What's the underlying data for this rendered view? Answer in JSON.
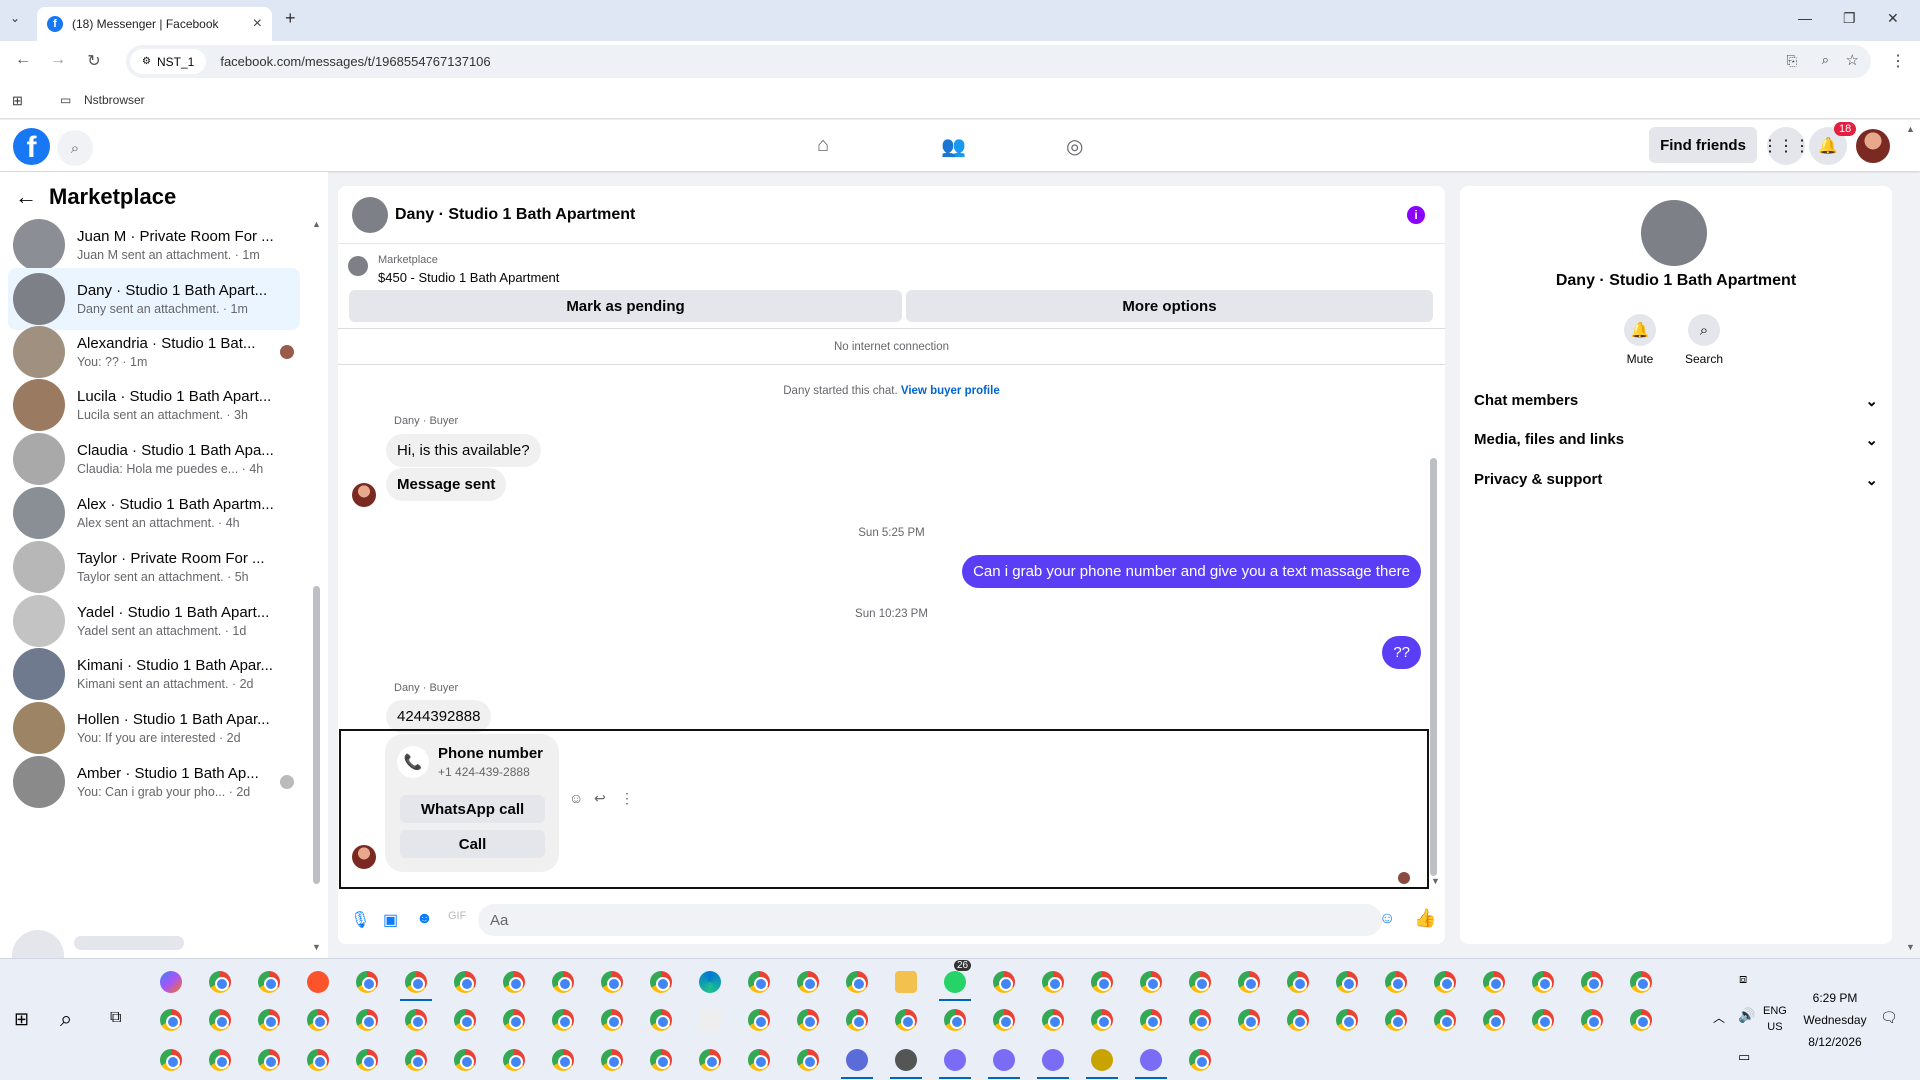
{
  "browser": {
    "tab_title": "(18) Messenger | Facebook",
    "profile": "NST_1",
    "url": "facebook.com/messages/t/1968554767137106",
    "bookmark": "Nstbrowser"
  },
  "header": {
    "find_friends": "Find friends",
    "notification_count": "18"
  },
  "sidebar": {
    "title": "Marketplace",
    "conversations": [
      {
        "name": "Juan M · Private Room For ...",
        "preview": "Juan M sent an attachment. · 1m",
        "color": "#8b8f95"
      },
      {
        "name": "Dany · Studio 1 Bath Apart...",
        "preview": "Dany sent an attachment. · 1m",
        "color": "#7d8086"
      },
      {
        "name": "Alexandria · Studio 1 Bat...",
        "preview": "You: ?? · 1m",
        "color": "#a09080"
      },
      {
        "name": "Lucila · Studio 1 Bath Apart...",
        "preview": "Lucila sent an attachment. · 3h",
        "color": "#9a7a60"
      },
      {
        "name": "Claudia · Studio 1 Bath Apa...",
        "preview": "Claudia: Hola me puedes e... · 4h",
        "color": "#a9a9a9"
      },
      {
        "name": "Alex · Studio 1 Bath Apartm...",
        "preview": "Alex sent an attachment. · 4h",
        "color": "#8a8f96"
      },
      {
        "name": "Taylor · Private Room For ...",
        "preview": "Taylor sent an attachment. · 5h",
        "color": "#b7b7b7"
      },
      {
        "name": "Yadel · Studio 1 Bath Apart...",
        "preview": "Yadel sent an attachment. · 1d",
        "color": "#c3c3c3"
      },
      {
        "name": "Kimani · Studio 1 Bath Apar...",
        "preview": "Kimani sent an attachment. · 2d",
        "color": "#6f7a8f"
      },
      {
        "name": "Hollen · Studio 1 Bath Apar...",
        "preview": "You: If you are interested · 2d",
        "color": "#9c8465"
      },
      {
        "name": "Amber · Studio 1 Bath Ap...",
        "preview": "You: Can i grab your pho... · 2d",
        "color": "#8a8a8a"
      }
    ]
  },
  "chat": {
    "title": "Dany · Studio 1 Bath Apartment",
    "listing_source": "Marketplace",
    "listing": "$450 - Studio 1 Bath Apartment",
    "mark_pending": "Mark as pending",
    "more_options": "More options",
    "no_internet": "No internet connection",
    "started": "Dany started this chat.",
    "view_profile": "View buyer profile",
    "sender_label_1": "Dany · Buyer",
    "msg_in_1": "Hi, is this available?",
    "msg_in_2": "Message sent",
    "time_1": "Sun 5:25 PM",
    "msg_out_1": "Can i grab your phone number and give  you a text massage there",
    "time_2": "Sun 10:23 PM",
    "msg_out_2": "??",
    "sender_label_2": "Dany · Buyer",
    "msg_in_3": "4244392888",
    "phone_label": "Phone number",
    "phone_value": "+1 424-439-2888",
    "whatsapp_call": "WhatsApp call",
    "call": "Call",
    "input_placeholder": "Aa"
  },
  "details": {
    "name": "Dany · Studio 1 Bath Apartment",
    "mute": "Mute",
    "search": "Search",
    "sections": [
      "Chat members",
      "Media, files and links",
      "Privacy & support"
    ]
  },
  "taskbar": {
    "whatsapp_badge": "26",
    "lang": "ENG",
    "region": "US",
    "time": "6:29 PM",
    "day": "Wednesday",
    "date": "8/12/2026"
  }
}
